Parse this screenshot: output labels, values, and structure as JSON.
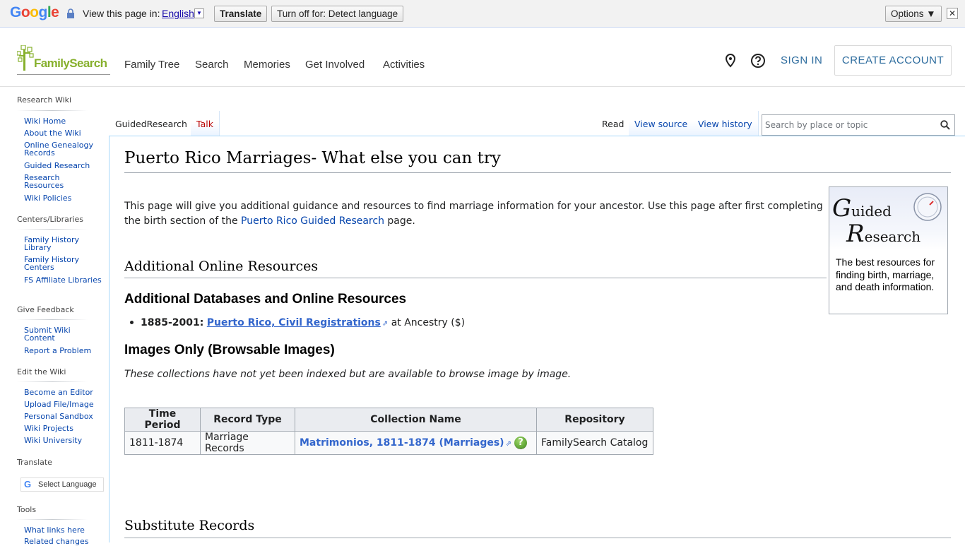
{
  "google_bar": {
    "logo_letters": [
      "G",
      "o",
      "o",
      "g",
      "l",
      "e"
    ],
    "view_label": "View this page in:",
    "language": "English",
    "translate_button": "Translate",
    "turnoff_button": "Turn off for: Detect language",
    "options_button": "Options ▼",
    "close_glyph": "✕"
  },
  "header": {
    "logo_text": "FamilySearch",
    "nav": [
      "Family Tree",
      "Search",
      "Memories",
      "Get Involved",
      "Activities"
    ],
    "sign_in": "SIGN IN",
    "create_account": "CREATE ACCOUNT"
  },
  "sidebar": {
    "sections": [
      {
        "heading": "Research Wiki",
        "links": [
          "Wiki Home",
          "About the Wiki",
          "Online Genealogy Records",
          "Guided Research",
          "Research Resources",
          "Wiki Policies"
        ]
      },
      {
        "heading": "Centers/Libraries",
        "links": [
          "Family History Library",
          "Family History Centers",
          "FS Affiliate Libraries"
        ]
      },
      {
        "heading": "Give Feedback",
        "links": [
          "Submit Wiki Content",
          "Report a Problem"
        ]
      },
      {
        "heading": "Edit the Wiki",
        "links": [
          "Become an Editor",
          "Upload File/Image",
          "Personal Sandbox",
          "Wiki Projects",
          "Wiki University"
        ]
      },
      {
        "heading": "Translate",
        "links": []
      },
      {
        "heading": "Tools",
        "links": [
          "What links here",
          "Related changes"
        ]
      }
    ],
    "select_language": "Select Language",
    "google_g": "G"
  },
  "tabs": {
    "page": "GuidedResearch",
    "talk": "Talk",
    "read": "Read",
    "view_source": "View source",
    "view_history": "View history"
  },
  "search": {
    "placeholder": "Search by place or topic"
  },
  "article": {
    "title": "Puerto Rico Marriages- What else you can try",
    "intro_1": "This page will give you additional guidance and resources to find marriage information for your ancestor. Use this page after first completing the birth section of the ",
    "intro_link": "Puerto Rico Guided Research",
    "intro_2": " page.",
    "guided_box": {
      "line1_big": "G",
      "line1_rest": "uided",
      "line2_big": "R",
      "line2_rest": "esearch",
      "desc": "The best resources for finding birth, marriage, and death information."
    },
    "h2_online": "Additional Online Resources",
    "h3_databases": "Additional Databases and Online Resources",
    "bullet_years": "1885-2001:",
    "bullet_link": "Puerto Rico, Civil Registrations",
    "bullet_suffix": " at Ancestry ($)",
    "h3_images": "Images Only (Browsable Images)",
    "images_note": "These collections have not yet been indexed but are available to browse image by image.",
    "table": {
      "headers": [
        "Time Period",
        "Record Type",
        "Collection Name",
        "Repository"
      ],
      "rows": [
        {
          "period": "1811-1874",
          "type": "Marriage Records",
          "collection": "Matrimonios, 1811-1874 (Marriages)",
          "repository": "FamilySearch Catalog"
        }
      ]
    },
    "h2_substitute": "Substitute Records"
  },
  "colors": {
    "link": "#0645ad",
    "fs_green": "#87b02d",
    "fs_blue": "#2d6c9e"
  }
}
